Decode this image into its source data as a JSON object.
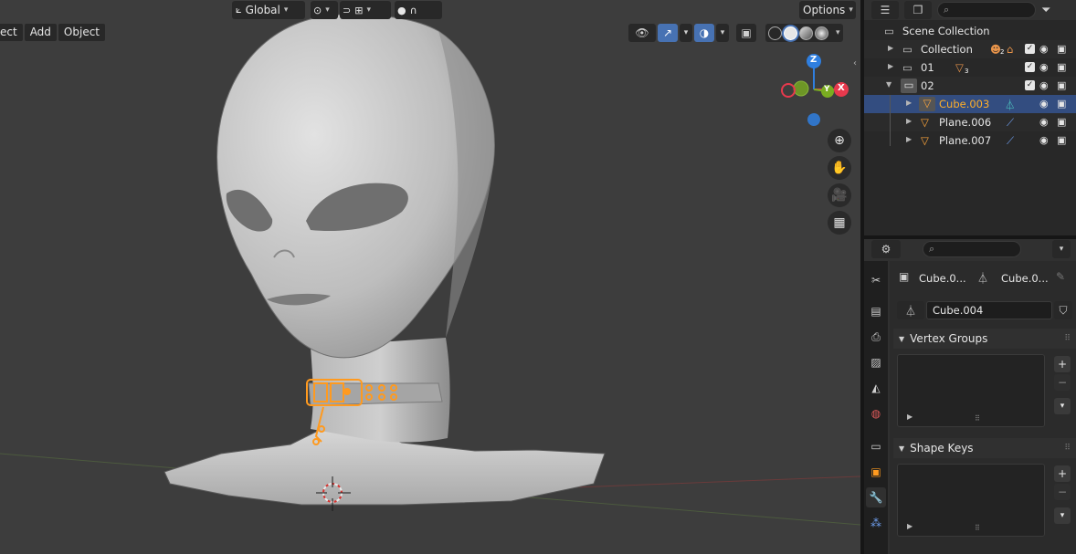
{
  "viewport": {
    "menu": [
      "ect",
      "Add",
      "Object"
    ],
    "transform_orientation": "Global",
    "options_label": "Options",
    "gizmo": {
      "z": "Z",
      "y": "Y",
      "x": "X"
    },
    "colors": {
      "background": "#3d3d3d",
      "selection": "#ff9a1f",
      "axis_x": "#e8394d",
      "axis_y": "#7aad21",
      "axis_z": "#2f7fe0"
    }
  },
  "outliner": {
    "search_placeholder": "",
    "rows": [
      {
        "label": "Scene Collection"
      },
      {
        "label": "Collection",
        "badge": "2"
      },
      {
        "label": "01",
        "badge": "3"
      },
      {
        "label": "02"
      },
      {
        "label": "Cube.003",
        "selected": true
      },
      {
        "label": "Plane.006"
      },
      {
        "label": "Plane.007"
      }
    ]
  },
  "properties": {
    "search_placeholder": "",
    "breadcrumb": {
      "object": "Cube.0...",
      "data": "Cube.0..."
    },
    "mesh_name": "Cube.004",
    "panels": {
      "vertex_groups": "Vertex Groups",
      "shape_keys": "Shape Keys"
    }
  }
}
